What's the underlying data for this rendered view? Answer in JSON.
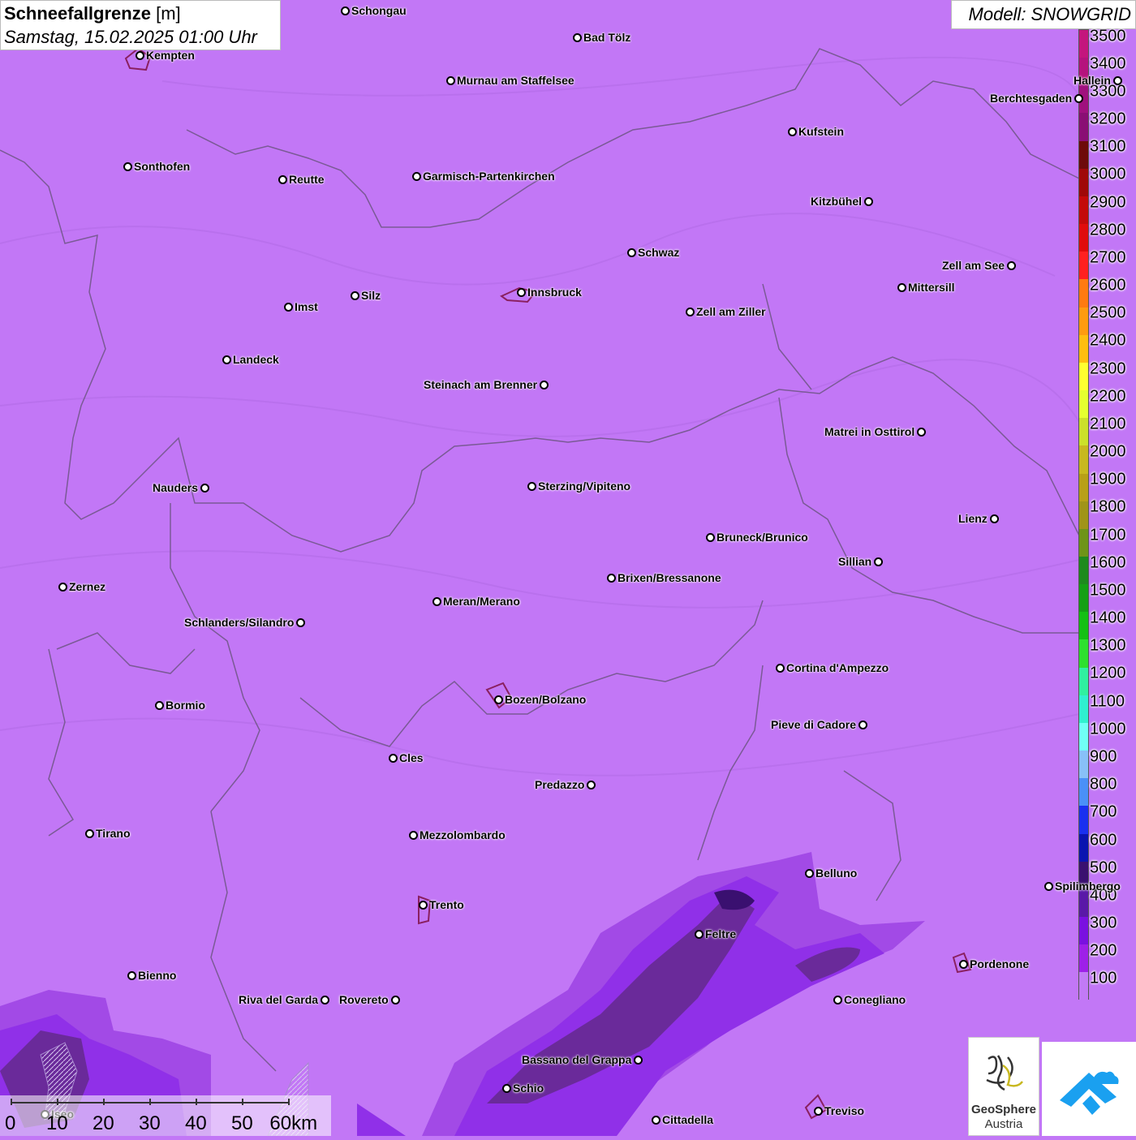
{
  "title": {
    "main": "Schneefallgrenze",
    "unit": "[m]",
    "datetime": "Samstag, 15.02.2025 01:00 Uhr"
  },
  "model": "Modell: SNOWGRID",
  "legend": {
    "labels": [
      "3500",
      "3400",
      "3300",
      "3200",
      "3100",
      "3000",
      "2900",
      "2800",
      "2700",
      "2600",
      "2500",
      "2400",
      "2300",
      "2200",
      "2100",
      "2000",
      "1900",
      "1800",
      "1700",
      "1600",
      "1500",
      "1400",
      "1300",
      "1200",
      "1100",
      "1000",
      "900",
      "800",
      "700",
      "600",
      "500",
      "400",
      "300",
      "200",
      "100"
    ],
    "colors": [
      "#c4157d",
      "#b5127d",
      "#a0107e",
      "#8a0e74",
      "#6e0a0a",
      "#a00808",
      "#c40a0a",
      "#e00c0c",
      "#ff2020",
      "#ff7a10",
      "#ff9b10",
      "#ffbe10",
      "#ffff30",
      "#e6ff30",
      "#cce02a",
      "#c8b820",
      "#b8a018",
      "#a09418",
      "#6e9418",
      "#1e8a1e",
      "#15a015",
      "#14c014",
      "#2ee02e",
      "#30f0a0",
      "#30f0d0",
      "#70fff6",
      "#88c0f8",
      "#4a90f8",
      "#1a30f0",
      "#0a14b0",
      "#3a1070",
      "#5a18a8",
      "#7a10e0",
      "#9e20e8",
      "#c27af6"
    ]
  },
  "cities": [
    {
      "name": "Schongau"
    },
    {
      "name": "Bad Tölz"
    },
    {
      "name": "Kempten"
    },
    {
      "name": "Murnau am Staffelsee"
    },
    {
      "name": "Hallein"
    },
    {
      "name": "Berchtesgaden"
    },
    {
      "name": "Kufstein"
    },
    {
      "name": "Sonthofen"
    },
    {
      "name": "Reutte"
    },
    {
      "name": "Garmisch-Partenkirchen"
    },
    {
      "name": "Kitzbühel"
    },
    {
      "name": "Schwaz"
    },
    {
      "name": "Zell am See"
    },
    {
      "name": "Innsbruck"
    },
    {
      "name": "Mittersill"
    },
    {
      "name": "Silz"
    },
    {
      "name": "Imst"
    },
    {
      "name": "Zell am Ziller"
    },
    {
      "name": "Landeck"
    },
    {
      "name": "Steinach am Brenner"
    },
    {
      "name": "Matrei in Osttirol"
    },
    {
      "name": "Nauders"
    },
    {
      "name": "Sterzing/Vipiteno"
    },
    {
      "name": "Lienz"
    },
    {
      "name": "Bruneck/Brunico"
    },
    {
      "name": "Sillian"
    },
    {
      "name": "Zernez"
    },
    {
      "name": "Brixen/Bressanone"
    },
    {
      "name": "Meran/Merano"
    },
    {
      "name": "Schlanders/Silandro"
    },
    {
      "name": "Cortina d'Ampezzo"
    },
    {
      "name": "Bozen/Bolzano"
    },
    {
      "name": "Bormio"
    },
    {
      "name": "Pieve di Cadore"
    },
    {
      "name": "Cles"
    },
    {
      "name": "Predazzo"
    },
    {
      "name": "Tirano"
    },
    {
      "name": "Mezzolombardo"
    },
    {
      "name": "Belluno"
    },
    {
      "name": "Spilimbergo"
    },
    {
      "name": "Trento"
    },
    {
      "name": "Feltre"
    },
    {
      "name": "Pordenone"
    },
    {
      "name": "Bienno"
    },
    {
      "name": "Riva del Garda"
    },
    {
      "name": "Rovereto"
    },
    {
      "name": "Conegliano"
    },
    {
      "name": "Bassano del Grappa"
    },
    {
      "name": "Schio"
    },
    {
      "name": "Treviso"
    },
    {
      "name": "Cittadella"
    },
    {
      "name": "Iseo"
    }
  ],
  "scale": {
    "labels": [
      "0",
      "10",
      "20",
      "30",
      "40",
      "50",
      "60km"
    ]
  },
  "logos": {
    "geosphere_line1": "GeoSphere",
    "geosphere_line2": "Austria"
  }
}
